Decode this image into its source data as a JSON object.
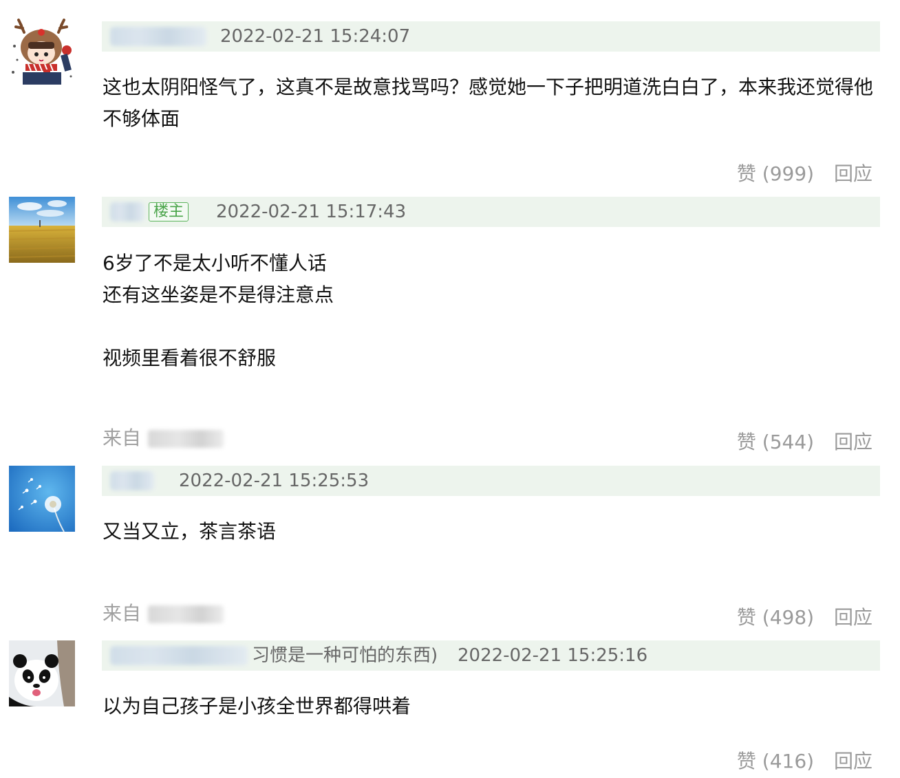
{
  "comments": [
    {
      "avatar": "reindeer-girl-avatar",
      "timestamp": "2022-02-21 15:24:07",
      "op_badge": "",
      "lines": [
        "这也太阴阳怪气了，这真不是故意找骂吗？感觉她一下子把明道洗白白了，本来我还觉得他",
        "不够体面"
      ],
      "from_label": "",
      "like_label": "赞 (999)",
      "reply_label": "回应"
    },
    {
      "avatar": "wheat-field-avatar",
      "timestamp": "2022-02-21 15:17:43",
      "op_badge": "楼主",
      "lines": [
        "6岁了不是太小听不懂人话",
        "还有这坐姿是不是得注意点",
        "",
        "视频里看着很不舒服"
      ],
      "from_label": "来自",
      "like_label": "赞 (544)",
      "reply_label": "回应"
    },
    {
      "avatar": "dandelion-avatar",
      "timestamp": "2022-02-21 15:25:53",
      "op_badge": "",
      "lines": [
        "又当又立，茶言茶语"
      ],
      "from_label": "来自",
      "like_label": "赞 (498)",
      "reply_label": "回应"
    },
    {
      "avatar": "panda-avatar",
      "timestamp": "2022-02-21 15:25:16",
      "op_badge": "",
      "username_suffix": "习惯是一种可怕的东西)",
      "lines": [
        "以为自己孩子是小孩全世界都得哄着"
      ],
      "from_label": "",
      "like_label": "赞 (416)",
      "reply_label": "回应"
    }
  ],
  "colors": {
    "meta_bar_bg": "#edf4ed",
    "op_badge": "#49a449",
    "muted_text": "#9a9a9a"
  }
}
